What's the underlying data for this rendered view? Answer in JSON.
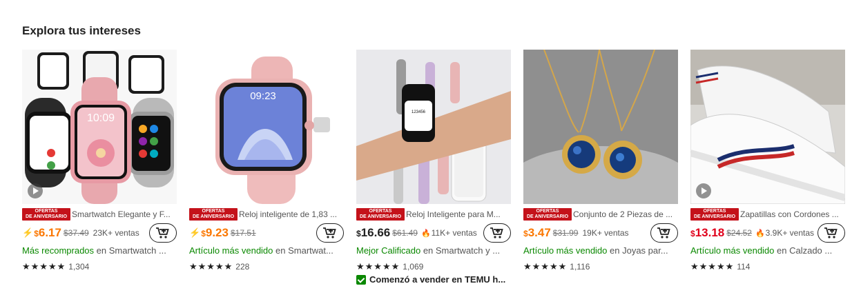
{
  "section": {
    "title": "Explora tus intereses"
  },
  "badge": {
    "line1": "OFERTAS",
    "line2": "DE ANIVERSARIO"
  },
  "products": [
    {
      "title": "Smartwatch Elegante y F...",
      "price_symbol": "$",
      "price_main": "6.17",
      "old_price": "$37.49",
      "sales": "23K+ ventas",
      "rank_label": "Más recomprados",
      "rank_in": " en Smartwatch ...",
      "rating_count": "1,304",
      "stars": "★★★★★",
      "has_bolt": true,
      "has_flame": false,
      "price_color": "orange",
      "has_video": true
    },
    {
      "title": "Reloj inteligente de 1,83 ...",
      "price_symbol": "$",
      "price_main": "9.23",
      "old_price": "$17.51",
      "sales": "",
      "rank_label": "Artículo más vendido",
      "rank_in": " en Smartwat...",
      "rating_count": "228",
      "stars": "★★★★★",
      "has_bolt": true,
      "has_flame": false,
      "price_color": "orange",
      "has_video": false
    },
    {
      "title": "Reloj Inteligente para M...",
      "price_symbol": "$",
      "price_main": "16.66",
      "old_price": "$61.49",
      "sales": "11K+ ventas",
      "rank_label": "Mejor Calificado",
      "rank_in": " en Smartwatch y ...",
      "rating_count": "1,069",
      "stars": "★★★★★",
      "has_bolt": false,
      "has_flame": true,
      "price_color": "black",
      "has_video": false,
      "extra": "Comenzó a vender en TEMU h..."
    },
    {
      "title": "Conjunto de 2 Piezas de ...",
      "price_symbol": "$",
      "price_main": "3.47",
      "old_price": "$31.99",
      "sales": "19K+ ventas",
      "rank_label": "Artículo más vendido",
      "rank_in": " en Joyas par...",
      "rating_count": "1,116",
      "stars": "★★★★★",
      "has_bolt": false,
      "has_flame": false,
      "price_color": "orange",
      "has_video": false
    },
    {
      "title": "Zapatillas con Cordones ...",
      "price_symbol": "$",
      "price_main": "13.18",
      "old_price": "$24.52",
      "sales": "3.9K+ ventas",
      "rank_label": "Artículo más vendido",
      "rank_in": " en Calzado ...",
      "rating_count": "114",
      "stars": "★★★★★",
      "has_bolt": false,
      "has_flame": true,
      "price_color": "red",
      "has_video": true
    }
  ]
}
